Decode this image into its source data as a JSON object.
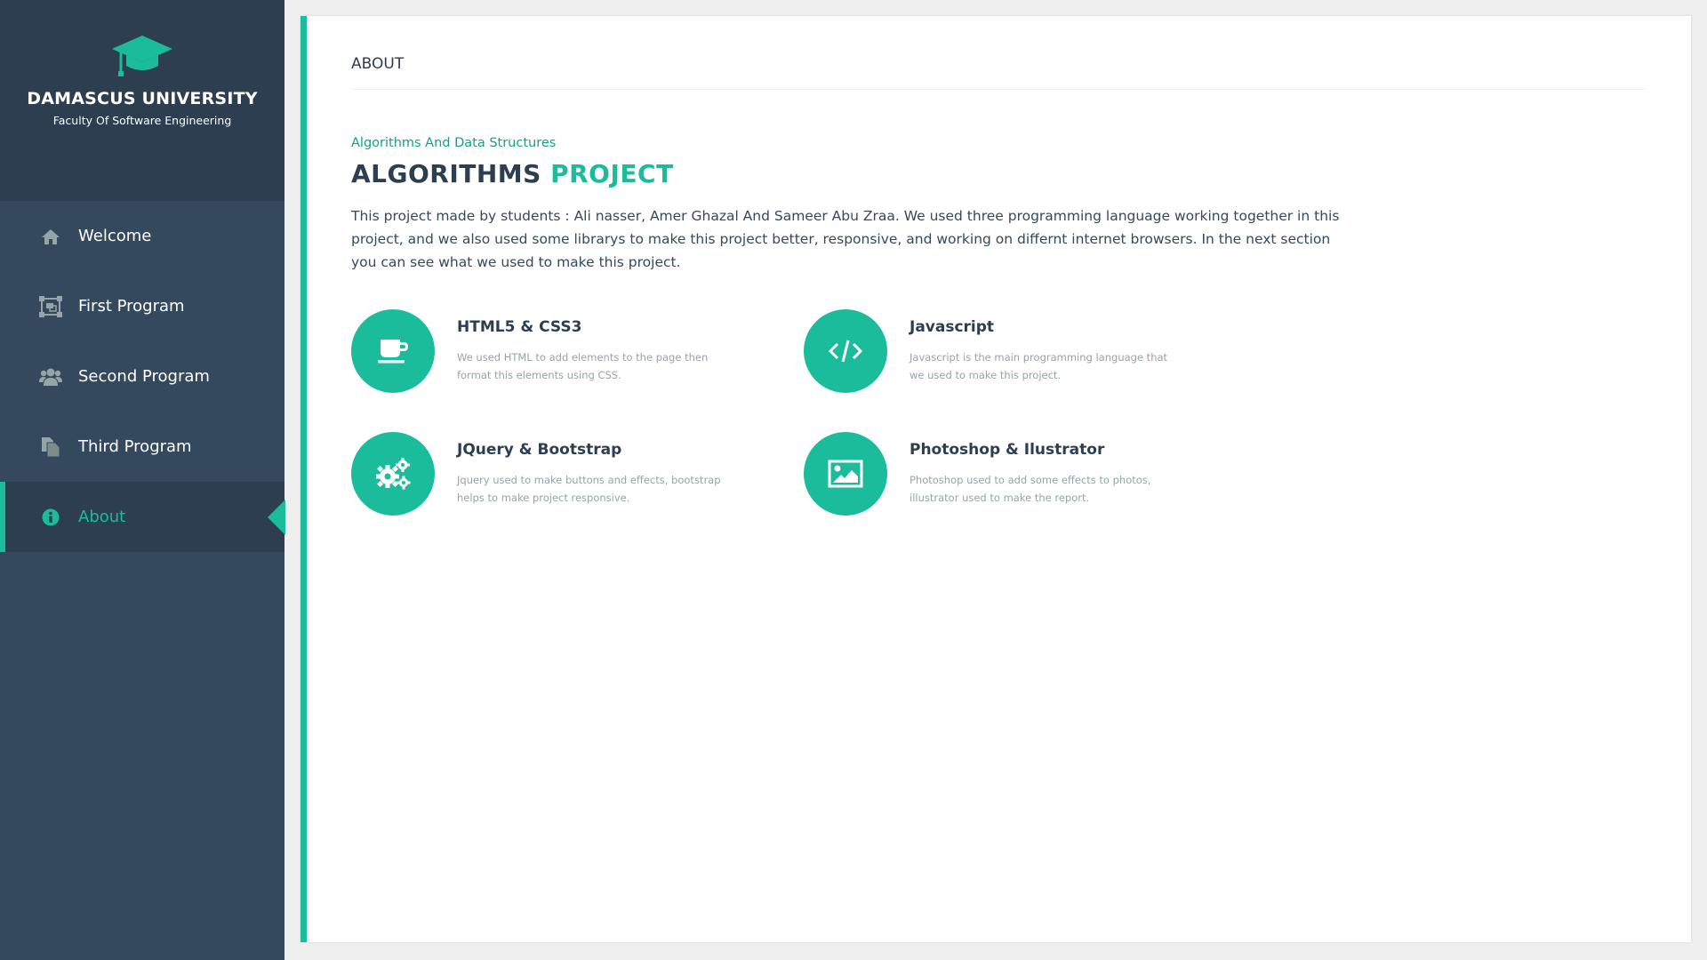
{
  "sidebar": {
    "brand_name": "DAMASCUS UNIVERSITY",
    "brand_sub": "Faculty Of Software Engineering",
    "brand_icon": "graduation-cap-icon",
    "items": [
      {
        "label": "Welcome",
        "icon": "home-icon"
      },
      {
        "label": "First Program",
        "icon": "object-group-icon"
      },
      {
        "label": "Second Program",
        "icon": "users-icon"
      },
      {
        "label": "Third Program",
        "icon": "files-icon"
      },
      {
        "label": "About",
        "icon": "info-circle-icon",
        "active": true
      }
    ]
  },
  "main": {
    "header": "ABOUT",
    "subtitle": "Algorithms And Data Structures",
    "title_main": "ALGORITHMS",
    "title_accent": "PROJECT",
    "description": "This project made by students : Ali nasser, Amer Ghazal And Sameer Abu Zraa. We used three programming language working together in this project, and we also used some librarys to make this project better, responsive, and working on differnt internet browsers. In the next section you can see what we used to make this project.",
    "features": [
      {
        "title": "HTML5 & CSS3",
        "desc": "We used HTML to add elements to the page then format this elements using CSS.",
        "icon": "coffee-cup-icon"
      },
      {
        "title": "Javascript",
        "desc": "Javascript is the main programming language that we used to make this project.",
        "icon": "code-icon"
      },
      {
        "title": "JQuery & Bootstrap",
        "desc": "Jquery used to make buttons and effects, bootstrap helps to make project responsive.",
        "icon": "gears-icon"
      },
      {
        "title": "Photoshop & Ilustrator",
        "desc": "Photoshop used to add some effects to photos, illustrator used to make the report.",
        "icon": "image-icon"
      }
    ]
  },
  "colors": {
    "accent": "#1abc9c",
    "accent_dark": "#16a085",
    "sidebar": "#34495e",
    "sidebar_dark": "#2c3e50"
  }
}
